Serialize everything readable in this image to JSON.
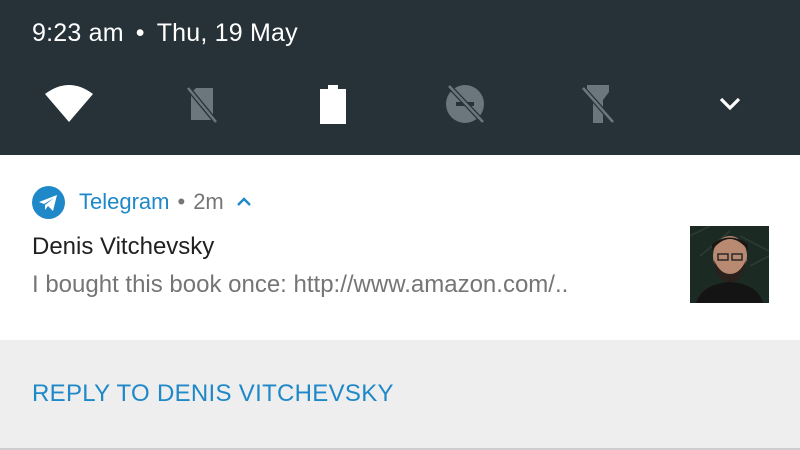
{
  "status_bar": {
    "time": "9:23 am",
    "separator": "•",
    "date": "Thu, 19 May"
  },
  "quick_settings": [
    {
      "name": "wifi-icon",
      "state": "on"
    },
    {
      "name": "no-sim-icon",
      "state": "off"
    },
    {
      "name": "battery-icon",
      "state": "full"
    },
    {
      "name": "data-saver-off-icon",
      "state": "off"
    },
    {
      "name": "flashlight-off-icon",
      "state": "off"
    },
    {
      "name": "expand-chevron-icon"
    }
  ],
  "notification": {
    "app_name": "Telegram",
    "separator": "•",
    "time_ago": "2m",
    "title": "Denis Vitchevsky",
    "body": "I bought this book once: http://www.amazon.com/.."
  },
  "actions": {
    "reply_label": "REPLY TO DENIS VITCHEVSKY"
  },
  "colors": {
    "shade_bg": "#263238",
    "accent": "#1e88c9",
    "action_bg": "#eeeeee"
  }
}
